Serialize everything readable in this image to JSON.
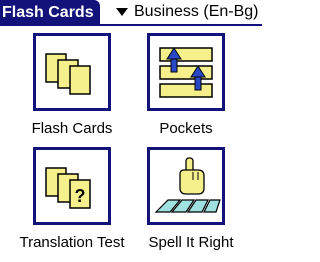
{
  "header": {
    "app_title": "Flash Cards",
    "category": {
      "selected": "Business (En-Bg)",
      "arrow_icon": "dropdown-triangle-icon"
    }
  },
  "menu": {
    "items": [
      {
        "label": "Flash Cards",
        "icon": "flash-cards-icon"
      },
      {
        "label": "Pockets",
        "icon": "pockets-icon"
      },
      {
        "label": "Translation Test",
        "icon": "translation-test-icon"
      },
      {
        "label": "Spell It Right",
        "icon": "spell-it-right-icon"
      }
    ]
  },
  "colors": {
    "header_bg": "#12127a",
    "tile_border": "#12127a",
    "card_fill": "#f6f08c",
    "arrow_blue": "#2848c8",
    "keyboard_key": "#9fe0e0"
  }
}
